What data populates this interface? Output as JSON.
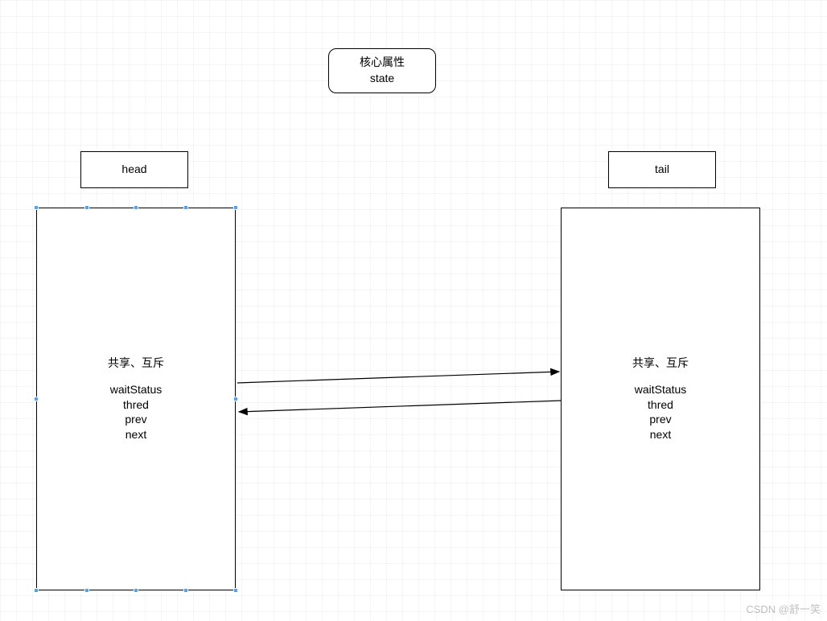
{
  "top_box": {
    "line1": "核心属性",
    "line2": "state"
  },
  "head_label": "head",
  "tail_label": "tail",
  "node_left": {
    "mode": "共享、互斥",
    "f1": "waitStatus",
    "f2": "thred",
    "f3": "prev",
    "f4": "next"
  },
  "node_right": {
    "mode": "共享、互斥",
    "f1": "waitStatus",
    "f2": "thred",
    "f3": "prev",
    "f4": "next"
  },
  "watermark": "CSDN @舒一笑"
}
